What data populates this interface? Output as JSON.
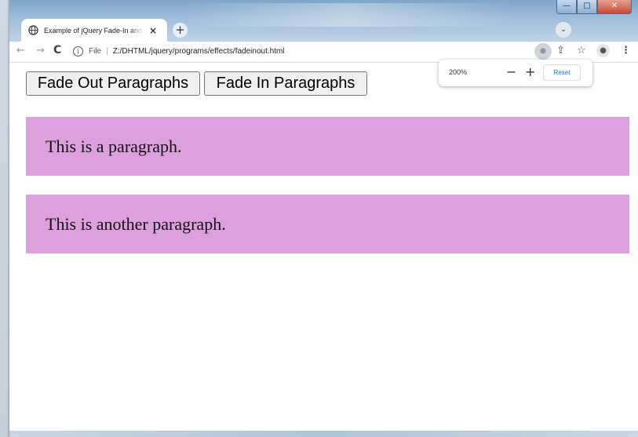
{
  "browser": {
    "tab_title": "Example of jQuery Fade-In and Fade-Out",
    "tab_close": "×",
    "new_tab": "+",
    "tab_search": "⌄",
    "caption": {
      "minimize": "—",
      "maximize": "□",
      "close": "✕"
    },
    "toolbar": {
      "back": "←",
      "forward": "→",
      "reload": "C",
      "scheme_label": "File",
      "url": "Z:/DHTML/jquery/programs/effects/fadeinout.html",
      "zoom_badge": "⊕",
      "share": "⇪",
      "star": "☆",
      "profile": "●",
      "menu": "⋮"
    }
  },
  "zoom_popup": {
    "level": "200%",
    "minus": "−",
    "plus": "+",
    "reset": "Reset"
  },
  "page": {
    "buttons": {
      "fade_out": "Fade Out Paragraphs",
      "fade_in": "Fade In Paragraphs"
    },
    "paragraphs": [
      "This is a paragraph.",
      "This is another paragraph."
    ],
    "paragraph_bg": "#dda0dd"
  }
}
